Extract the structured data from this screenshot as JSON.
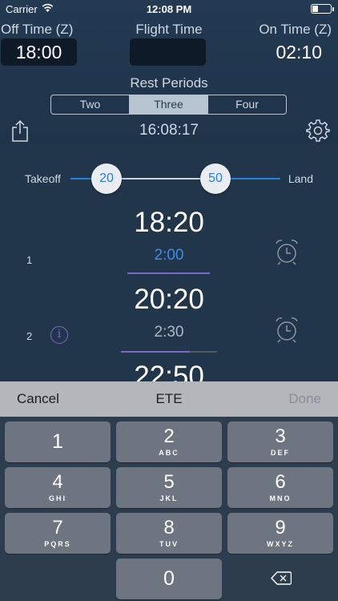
{
  "status": {
    "carrier": "Carrier",
    "time": "12:08 PM"
  },
  "header": {
    "off_label": "Off Time (Z)",
    "off_value": "18:00",
    "flight_label": "Flight Time",
    "flight_value": "",
    "on_label": "On Time (Z)",
    "on_value": "02:10"
  },
  "rest": {
    "title": "Rest Periods",
    "options": [
      "Two",
      "Three",
      "Four"
    ],
    "selected": "Three"
  },
  "clock": "16:08:17",
  "slider": {
    "left_label": "Takeoff",
    "right_label": "Land",
    "start": "20",
    "end": "50"
  },
  "periods": [
    {
      "number": "1",
      "start": "18:20",
      "duration": "2:00"
    },
    {
      "number": "2",
      "start": "20:20",
      "duration": "2:30"
    },
    {
      "start": "22:50"
    }
  ],
  "keyboard_bar": {
    "cancel": "Cancel",
    "title": "ETE",
    "done": "Done"
  },
  "keys": [
    {
      "num": "1",
      "letters": ""
    },
    {
      "num": "2",
      "letters": "ABC"
    },
    {
      "num": "3",
      "letters": "DEF"
    },
    {
      "num": "4",
      "letters": "GHI"
    },
    {
      "num": "5",
      "letters": "JKL"
    },
    {
      "num": "6",
      "letters": "MNO"
    },
    {
      "num": "7",
      "letters": "PQRS"
    },
    {
      "num": "8",
      "letters": "TUV"
    },
    {
      "num": "9",
      "letters": "WXYZ"
    },
    {
      "num": "0",
      "letters": ""
    }
  ],
  "colors": {
    "accent_blue": "#2a7de1",
    "accent_purple": "#7d68c6",
    "background": "#22364b"
  }
}
